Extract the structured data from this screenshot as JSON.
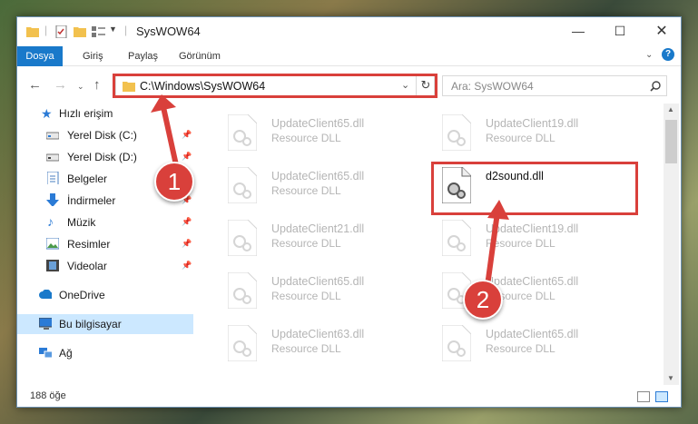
{
  "window": {
    "title": "SysWOW64",
    "ribbon_tabs": [
      "Dosya",
      "Giriş",
      "Paylaş",
      "Görünüm"
    ]
  },
  "address": {
    "path": "C:\\Windows\\SysWOW64"
  },
  "search": {
    "placeholder": "Ara: SysWOW64"
  },
  "sidebar": {
    "items": [
      {
        "label": "Hızlı erişim",
        "icon": "star-icon",
        "pinned": false
      },
      {
        "label": "Yerel Disk (C:)",
        "icon": "drive-icon",
        "pinned": true
      },
      {
        "label": "Yerel Disk (D:)",
        "icon": "drive-icon",
        "pinned": true
      },
      {
        "label": "Belgeler",
        "icon": "documents-icon",
        "pinned": true
      },
      {
        "label": "İndirmeler",
        "icon": "download-icon",
        "pinned": true
      },
      {
        "label": "Müzik",
        "icon": "music-icon",
        "pinned": true
      },
      {
        "label": "Resimler",
        "icon": "pictures-icon",
        "pinned": true
      },
      {
        "label": "Videolar",
        "icon": "videos-icon",
        "pinned": true
      },
      {
        "label": "OneDrive",
        "icon": "cloud-icon",
        "pinned": false
      },
      {
        "label": "Bu bilgisayar",
        "icon": "computer-icon",
        "pinned": false,
        "selected": true
      },
      {
        "label": "Ağ",
        "icon": "network-icon",
        "pinned": false
      }
    ]
  },
  "files": [
    {
      "name": "UpdateClient65.dll",
      "type": "Resource DLL"
    },
    {
      "name": "UpdateClient19.dll",
      "type": "Resource DLL"
    },
    {
      "name": "UpdateClient65.dll",
      "type": "Resource DLL"
    },
    {
      "name": "d2sound.dll",
      "type": ""
    },
    {
      "name": "UpdateClient21.dll",
      "type": "Resource DLL"
    },
    {
      "name": "UpdateClient19.dll",
      "type": "Resource DLL"
    },
    {
      "name": "UpdateClient65.dll",
      "type": "Resource DLL"
    },
    {
      "name": "UpdateClient65.dll",
      "type": "Resource DLL"
    },
    {
      "name": "UpdateClient63.dll",
      "type": "Resource DLL"
    },
    {
      "name": "UpdateClient65.dll",
      "type": "Resource DLL"
    }
  ],
  "status": {
    "item_count": "188 öğe"
  },
  "callouts": [
    "1",
    "2"
  ],
  "colors": {
    "accent": "#1979ca",
    "highlight": "#d9403b",
    "selected_bg": "#cce8ff"
  }
}
